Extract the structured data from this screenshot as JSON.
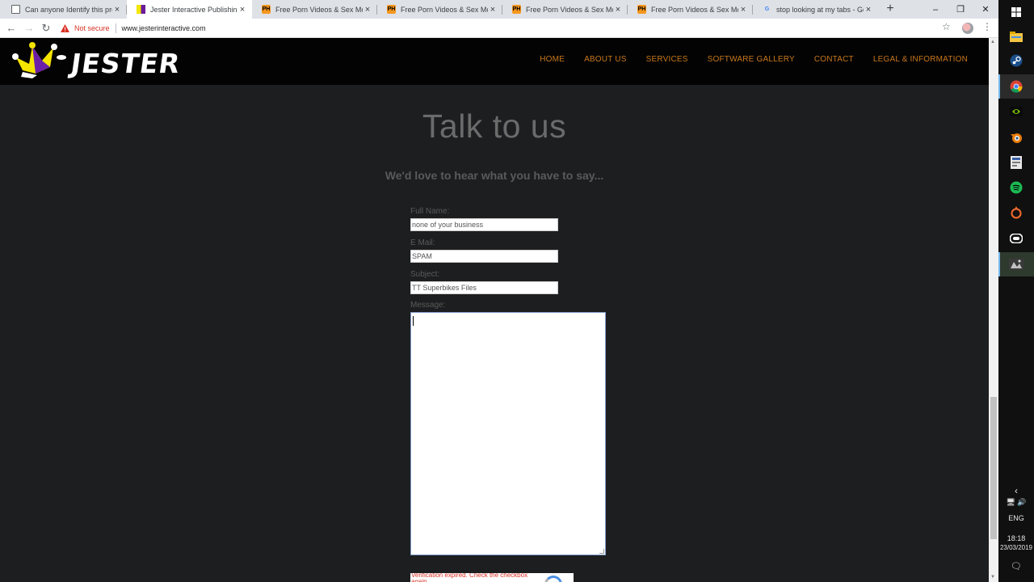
{
  "browser": {
    "tabs": [
      {
        "title": "Can anyone Identify this program",
        "favicon": "document-icon",
        "active": false
      },
      {
        "title": "Jester Interactive Publishing Limited",
        "favicon": "jester-favicon",
        "active": true
      },
      {
        "title": "Free Porn Videos & Sex Movies",
        "favicon": "ph-favicon",
        "active": false
      },
      {
        "title": "Free Porn Videos & Sex Movies",
        "favicon": "ph-favicon",
        "active": false
      },
      {
        "title": "Free Porn Videos & Sex Movies",
        "favicon": "ph-favicon",
        "active": false
      },
      {
        "title": "Free Porn Videos & Sex Movies",
        "favicon": "ph-favicon",
        "active": false
      },
      {
        "title": "stop looking at my tabs - Google",
        "favicon": "google-icon",
        "active": false
      }
    ],
    "tab_icons": {
      "ph": "PH",
      "google": "G",
      "close": "×",
      "new_tab": "+"
    },
    "window_controls": {
      "minimize": "–",
      "restore": "❐",
      "close": "✕"
    },
    "security_label": "Not secure",
    "url": "www.jesterinteractive.com",
    "nav_glyphs": {
      "back": "←",
      "forward": "→",
      "reload": "↻",
      "star": "☆",
      "menu": "⋮"
    }
  },
  "site": {
    "logo_text": "JESTER",
    "nav": [
      "HOME",
      "ABOUT US",
      "SERVICES",
      "SOFTWARE GALLERY",
      "CONTACT",
      "LEGAL & INFORMATION"
    ],
    "heading": "Talk to us",
    "subheading": "We'd love to hear what you have to say...",
    "form": {
      "full_name_label": "Full Name:",
      "full_name_value": "none of your business",
      "email_label": "E Mail:",
      "email_value": "SPAM",
      "subject_label": "Subject:",
      "subject_value": "TT Superbikes Files",
      "message_label": "Message:",
      "message_value": ""
    },
    "recaptcha_error": "Verification expired. Check the checkbox again."
  },
  "taskbar": {
    "apps": [
      "windows-icon",
      "file-explorer-icon",
      "steam-icon",
      "chrome-icon",
      "nvidia-icon",
      "blender-icon",
      "app-icon",
      "spotify-icon",
      "origin-icon",
      "oculus-icon",
      "game-icon"
    ],
    "collapse_glyph": "‹",
    "tray_glyphs": "🖥 🔊",
    "language": "ENG",
    "time": "18:18",
    "date": "23/03/2019",
    "notification_glyph": "🗨"
  }
}
